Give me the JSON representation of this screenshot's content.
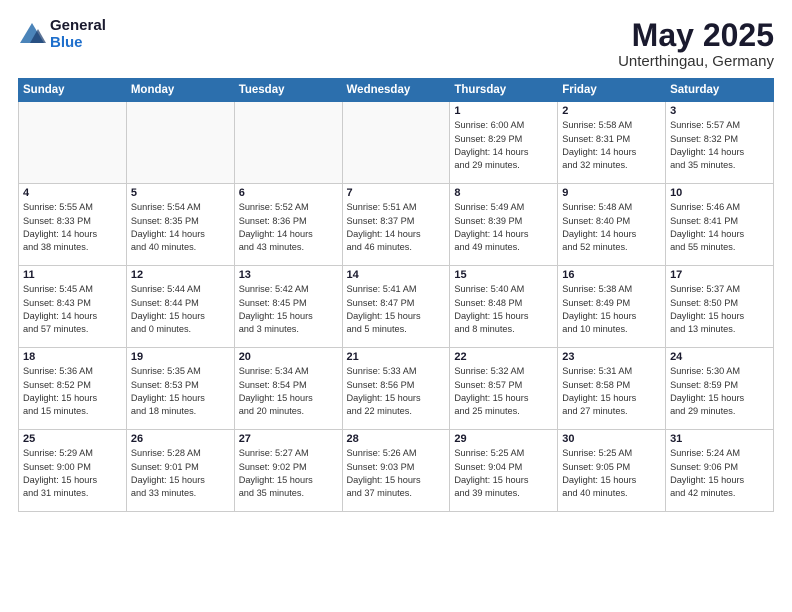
{
  "logo": {
    "general": "General",
    "blue": "Blue"
  },
  "header": {
    "title": "May 2025",
    "subtitle": "Unterthingau, Germany"
  },
  "weekdays": [
    "Sunday",
    "Monday",
    "Tuesday",
    "Wednesday",
    "Thursday",
    "Friday",
    "Saturday"
  ],
  "weeks": [
    [
      {
        "day": "",
        "info": ""
      },
      {
        "day": "",
        "info": ""
      },
      {
        "day": "",
        "info": ""
      },
      {
        "day": "",
        "info": ""
      },
      {
        "day": "1",
        "info": "Sunrise: 6:00 AM\nSunset: 8:29 PM\nDaylight: 14 hours\nand 29 minutes."
      },
      {
        "day": "2",
        "info": "Sunrise: 5:58 AM\nSunset: 8:31 PM\nDaylight: 14 hours\nand 32 minutes."
      },
      {
        "day": "3",
        "info": "Sunrise: 5:57 AM\nSunset: 8:32 PM\nDaylight: 14 hours\nand 35 minutes."
      }
    ],
    [
      {
        "day": "4",
        "info": "Sunrise: 5:55 AM\nSunset: 8:33 PM\nDaylight: 14 hours\nand 38 minutes."
      },
      {
        "day": "5",
        "info": "Sunrise: 5:54 AM\nSunset: 8:35 PM\nDaylight: 14 hours\nand 40 minutes."
      },
      {
        "day": "6",
        "info": "Sunrise: 5:52 AM\nSunset: 8:36 PM\nDaylight: 14 hours\nand 43 minutes."
      },
      {
        "day": "7",
        "info": "Sunrise: 5:51 AM\nSunset: 8:37 PM\nDaylight: 14 hours\nand 46 minutes."
      },
      {
        "day": "8",
        "info": "Sunrise: 5:49 AM\nSunset: 8:39 PM\nDaylight: 14 hours\nand 49 minutes."
      },
      {
        "day": "9",
        "info": "Sunrise: 5:48 AM\nSunset: 8:40 PM\nDaylight: 14 hours\nand 52 minutes."
      },
      {
        "day": "10",
        "info": "Sunrise: 5:46 AM\nSunset: 8:41 PM\nDaylight: 14 hours\nand 55 minutes."
      }
    ],
    [
      {
        "day": "11",
        "info": "Sunrise: 5:45 AM\nSunset: 8:43 PM\nDaylight: 14 hours\nand 57 minutes."
      },
      {
        "day": "12",
        "info": "Sunrise: 5:44 AM\nSunset: 8:44 PM\nDaylight: 15 hours\nand 0 minutes."
      },
      {
        "day": "13",
        "info": "Sunrise: 5:42 AM\nSunset: 8:45 PM\nDaylight: 15 hours\nand 3 minutes."
      },
      {
        "day": "14",
        "info": "Sunrise: 5:41 AM\nSunset: 8:47 PM\nDaylight: 15 hours\nand 5 minutes."
      },
      {
        "day": "15",
        "info": "Sunrise: 5:40 AM\nSunset: 8:48 PM\nDaylight: 15 hours\nand 8 minutes."
      },
      {
        "day": "16",
        "info": "Sunrise: 5:38 AM\nSunset: 8:49 PM\nDaylight: 15 hours\nand 10 minutes."
      },
      {
        "day": "17",
        "info": "Sunrise: 5:37 AM\nSunset: 8:50 PM\nDaylight: 15 hours\nand 13 minutes."
      }
    ],
    [
      {
        "day": "18",
        "info": "Sunrise: 5:36 AM\nSunset: 8:52 PM\nDaylight: 15 hours\nand 15 minutes."
      },
      {
        "day": "19",
        "info": "Sunrise: 5:35 AM\nSunset: 8:53 PM\nDaylight: 15 hours\nand 18 minutes."
      },
      {
        "day": "20",
        "info": "Sunrise: 5:34 AM\nSunset: 8:54 PM\nDaylight: 15 hours\nand 20 minutes."
      },
      {
        "day": "21",
        "info": "Sunrise: 5:33 AM\nSunset: 8:56 PM\nDaylight: 15 hours\nand 22 minutes."
      },
      {
        "day": "22",
        "info": "Sunrise: 5:32 AM\nSunset: 8:57 PM\nDaylight: 15 hours\nand 25 minutes."
      },
      {
        "day": "23",
        "info": "Sunrise: 5:31 AM\nSunset: 8:58 PM\nDaylight: 15 hours\nand 27 minutes."
      },
      {
        "day": "24",
        "info": "Sunrise: 5:30 AM\nSunset: 8:59 PM\nDaylight: 15 hours\nand 29 minutes."
      }
    ],
    [
      {
        "day": "25",
        "info": "Sunrise: 5:29 AM\nSunset: 9:00 PM\nDaylight: 15 hours\nand 31 minutes."
      },
      {
        "day": "26",
        "info": "Sunrise: 5:28 AM\nSunset: 9:01 PM\nDaylight: 15 hours\nand 33 minutes."
      },
      {
        "day": "27",
        "info": "Sunrise: 5:27 AM\nSunset: 9:02 PM\nDaylight: 15 hours\nand 35 minutes."
      },
      {
        "day": "28",
        "info": "Sunrise: 5:26 AM\nSunset: 9:03 PM\nDaylight: 15 hours\nand 37 minutes."
      },
      {
        "day": "29",
        "info": "Sunrise: 5:25 AM\nSunset: 9:04 PM\nDaylight: 15 hours\nand 39 minutes."
      },
      {
        "day": "30",
        "info": "Sunrise: 5:25 AM\nSunset: 9:05 PM\nDaylight: 15 hours\nand 40 minutes."
      },
      {
        "day": "31",
        "info": "Sunrise: 5:24 AM\nSunset: 9:06 PM\nDaylight: 15 hours\nand 42 minutes."
      }
    ]
  ]
}
